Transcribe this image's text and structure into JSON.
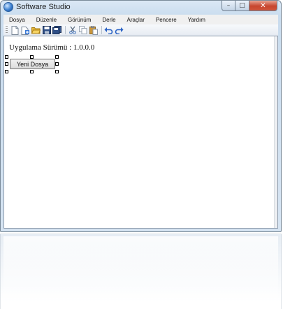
{
  "window": {
    "title": "Software Studio",
    "minimize_glyph": "–",
    "maximize_glyph": "□",
    "close_glyph": "✕"
  },
  "menu": {
    "items": [
      {
        "label": "Dosya"
      },
      {
        "label": "Düzenle"
      },
      {
        "label": "Görünüm"
      },
      {
        "label": "Derle"
      },
      {
        "label": "Araçlar"
      },
      {
        "label": "Pencere"
      },
      {
        "label": "Yardım"
      }
    ]
  },
  "toolbar": {
    "icons": [
      "new-file-icon",
      "add-item-icon",
      "open-folder-icon",
      "save-icon",
      "save-all-icon",
      "cut-icon",
      "copy-icon",
      "paste-icon",
      "undo-icon",
      "redo-icon"
    ]
  },
  "content": {
    "version_label": "Uygulama Sürümü : 1.0.0.0",
    "new_file_button": "Yeni Dosya"
  },
  "colors": {
    "window_frame": "#c9dcee",
    "close_button": "#c7452f",
    "client_background": "#ffffff"
  }
}
